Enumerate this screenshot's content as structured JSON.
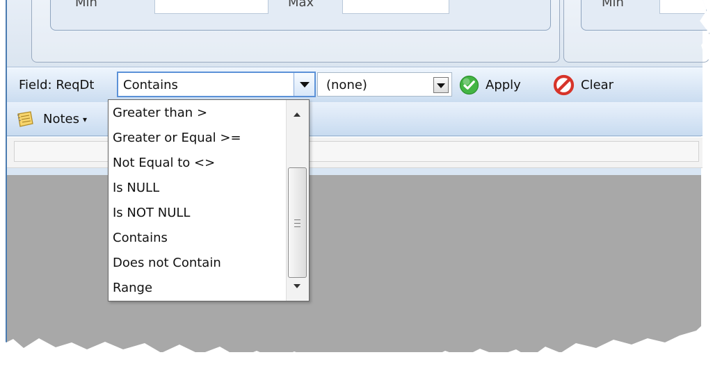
{
  "window": {
    "top_panel_labels": [
      "Min",
      "Max",
      "Min"
    ]
  },
  "filter_bar": {
    "field_label": "Field: ReqDt",
    "operator": {
      "selected": "Contains"
    },
    "value_selector": {
      "selected": "(none)"
    },
    "apply_label": "Apply",
    "clear_label": "Clear",
    "icons": {
      "apply": "check-circle-icon",
      "clear": "prohibited-icon",
      "dropdown": "chevron-down-icon"
    }
  },
  "notes_bar": {
    "notes_label": "Notes",
    "notes_icon": "notes-icon"
  },
  "operator_dropdown": {
    "items": [
      "Greater than >",
      "Greater or Equal >=",
      "Not Equal to <>",
      "Is NULL",
      "Is NOT NULL",
      "Contains",
      "Does not Contain",
      "Range"
    ]
  },
  "colors": {
    "frame_blue": "#4a7bb0",
    "toolbar_top": "#eef5fd",
    "toolbar_bottom": "#cadcf0",
    "focus_blue": "#5b91d7",
    "workspace_gray": "#a8a8a8",
    "apply_green": "#43b544",
    "clear_red": "#d7342a"
  }
}
